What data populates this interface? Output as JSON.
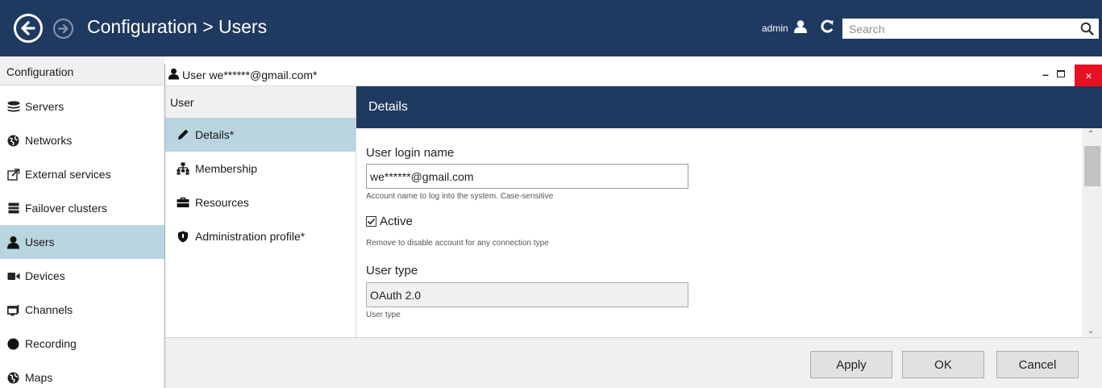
{
  "header": {
    "title": "Configuration > Users",
    "user_label": "admin",
    "search_placeholder": "Search"
  },
  "sidebar": {
    "header": "Configuration",
    "items": [
      {
        "label": "Servers",
        "icon": "servers-icon"
      },
      {
        "label": "Networks",
        "icon": "networks-icon"
      },
      {
        "label": "External services",
        "icon": "external-services-icon"
      },
      {
        "label": "Failover clusters",
        "icon": "failover-clusters-icon"
      },
      {
        "label": "Users",
        "icon": "user-icon",
        "selected": true
      },
      {
        "label": "Devices",
        "icon": "camera-icon"
      },
      {
        "label": "Channels",
        "icon": "channels-icon"
      },
      {
        "label": "Recording",
        "icon": "record-icon"
      },
      {
        "label": "Maps",
        "icon": "map-icon"
      }
    ]
  },
  "dialog": {
    "title": "User we******@gmail.com*",
    "controls": {
      "close": "×"
    },
    "nav": {
      "header": "User",
      "items": [
        {
          "label": "Details*",
          "icon": "pencil-icon",
          "selected": true
        },
        {
          "label": "Membership",
          "icon": "hierarchy-icon"
        },
        {
          "label": "Resources",
          "icon": "briefcase-icon"
        },
        {
          "label": "Administration profile*",
          "icon": "shield-icon"
        }
      ]
    },
    "details": {
      "header": "Details",
      "login_label": "User login name",
      "login_value": "we******@gmail.com",
      "login_hint": "Account name to log into the system. Case-sensitive",
      "active_label": "Active",
      "active_checked": true,
      "active_hint": "Remove to disable account for any connection type",
      "type_label": "User type",
      "type_value": "OAuth 2.0",
      "type_hint": "User type"
    },
    "buttons": {
      "apply": "Apply",
      "ok": "OK",
      "cancel": "Cancel"
    }
  },
  "colors": {
    "header_bg": "#1f3a60",
    "selected_bg": "#b8d5e0",
    "close_bg": "#e81123"
  }
}
